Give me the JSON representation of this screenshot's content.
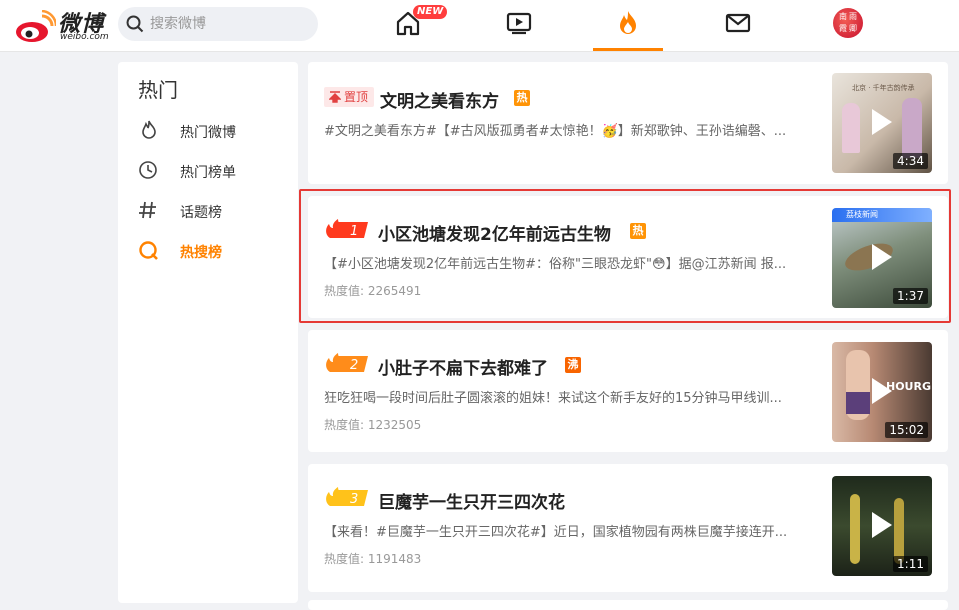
{
  "colors": {
    "accent": "#ff8200",
    "highlight": "#e53935",
    "hot_tag": "#ff9406",
    "boil_tag": "#f86400"
  },
  "header": {
    "logo_text": "微博",
    "logo_sub": "weibo.com",
    "search_placeholder": "搜索微博",
    "new_badge": "NEW",
    "nav_icons": [
      "home-icon",
      "video-icon",
      "hot-flame-icon",
      "mail-icon"
    ],
    "avatar_text": [
      "南",
      "雨",
      "霞",
      "卿"
    ]
  },
  "sidebar": {
    "title": "热门",
    "items": [
      {
        "label": "热门微博",
        "icon": "flame-outline-icon",
        "active": false
      },
      {
        "label": "热门榜单",
        "icon": "clock-icon",
        "active": false
      },
      {
        "label": "话题榜",
        "icon": "hashtag-icon",
        "active": false
      },
      {
        "label": "热搜榜",
        "icon": "search-q-icon",
        "active": true
      }
    ]
  },
  "feed": {
    "cards": [
      {
        "pin_label": "置顶",
        "title": "文明之美看东方",
        "tag": "热",
        "desc": "#文明之美看东方#【#古风版孤勇者#太惊艳！🥳】新郑歌钟、王孙诰编磬、...",
        "heat_label": "",
        "heat_value": "",
        "duration": "4:34",
        "thumb_text": "北京 · 千年古韵传承"
      },
      {
        "rank": "1",
        "title": "小区池塘发现2亿年前远古生物",
        "tag": "热",
        "desc": "【#小区池塘发现2亿年前远古生物#：俗称\"三眼恐龙虾\"😳】据@江苏新闻 报...",
        "heat_label": "热度值:",
        "heat_value": "2265491",
        "duration": "1:37",
        "thumb_text": "荔枝新闻"
      },
      {
        "rank": "2",
        "title": "小肚子不扁下去都难了",
        "tag": "沸",
        "desc": "狂吃狂喝一段时间后肚子圆滚滚的姐妹！来试这个新手友好的15分钟马甲线训...",
        "heat_label": "热度值:",
        "heat_value": "1232505",
        "duration": "15:02",
        "thumb_text": "HOURG"
      },
      {
        "rank": "3",
        "title": "巨魔芋一生只开三四次花",
        "tag": "",
        "desc": "【来看！#巨魔芋一生只开三四次花#】近日，国家植物园有两株巨魔芋接连开...",
        "heat_label": "热度值:",
        "heat_value": "1191483",
        "duration": "1:11",
        "thumb_text": ""
      }
    ]
  }
}
